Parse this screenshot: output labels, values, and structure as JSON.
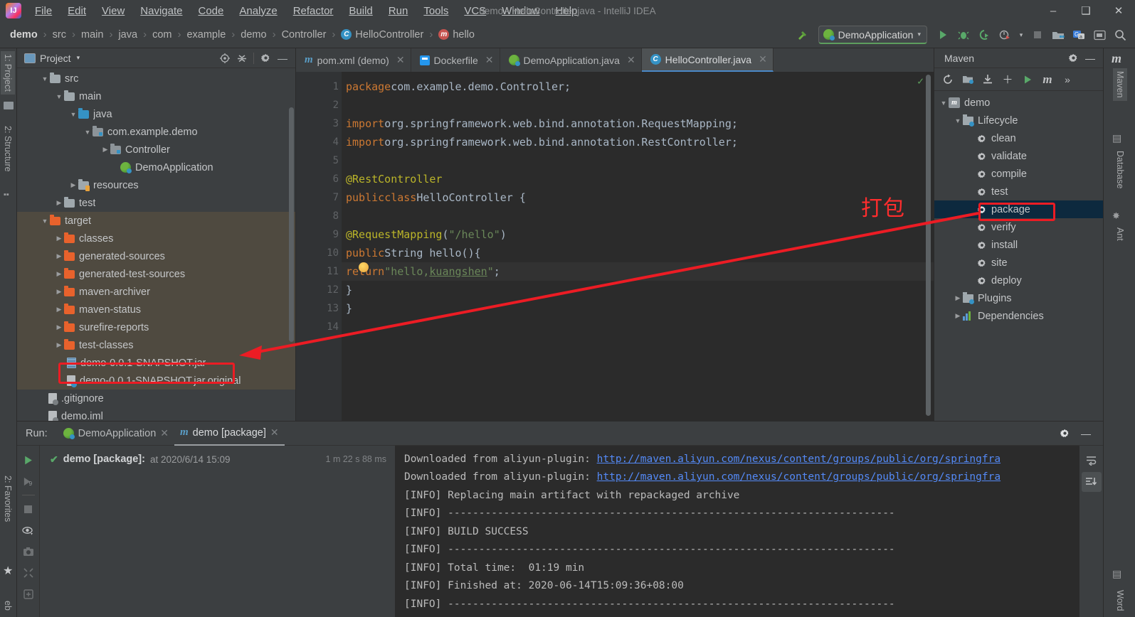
{
  "window": {
    "title": "demo - HelloController.java - IntelliJ IDEA",
    "logo_text": "IJ",
    "minimize": "–",
    "maximize": "❑",
    "close": "✕"
  },
  "menubar": {
    "items": [
      {
        "label": "File"
      },
      {
        "label": "Edit"
      },
      {
        "label": "View"
      },
      {
        "label": "Navigate"
      },
      {
        "label": "Code"
      },
      {
        "label": "Analyze"
      },
      {
        "label": "Refactor"
      },
      {
        "label": "Build"
      },
      {
        "label": "Run"
      },
      {
        "label": "Tools"
      },
      {
        "label": "VCS"
      },
      {
        "label": "Window"
      },
      {
        "label": "Help"
      }
    ]
  },
  "breadcrumb": {
    "items": [
      {
        "label": "demo",
        "icon": ""
      },
      {
        "label": "src",
        "icon": ""
      },
      {
        "label": "main",
        "icon": ""
      },
      {
        "label": "java",
        "icon": ""
      },
      {
        "label": "com",
        "icon": ""
      },
      {
        "label": "example",
        "icon": ""
      },
      {
        "label": "demo",
        "icon": ""
      },
      {
        "label": "Controller",
        "icon": ""
      },
      {
        "label": "HelloController",
        "icon": "class-icon"
      },
      {
        "label": "hello",
        "icon": "method-icon"
      }
    ],
    "separator": "›"
  },
  "toolbar": {
    "build_icon": "hammer-icon",
    "run_config": "DemoApplication",
    "run_config_caret": "▾",
    "run_icon": "▶",
    "debug_icon": "debug-icon",
    "run_coverage_icon": "run-with-coverage-icon",
    "profile_icon": "profiler-icon",
    "profile_caret": "▾",
    "stop_icon": "■",
    "project_structure_icon": "project-structure-icon",
    "translate_icon": "translate-icon",
    "terminal_icon": "terminal-icon",
    "search_icon": "search-icon"
  },
  "left_stripe": {
    "project_label": "1: Project",
    "structure_label": "2: Structure",
    "favorites_label": "2: Favorites",
    "web_label": "eb"
  },
  "right_stripe": {
    "maven_label": "Maven",
    "database_label": "Database",
    "ant_label": "Ant",
    "word_label": "Word",
    "maven_icon": "m"
  },
  "project_panel": {
    "title": "Project",
    "caret": "▾",
    "locate_icon": "locate-in-tree-icon",
    "collapse_icon": "collapse-all-icon",
    "settings_icon": "gear-icon",
    "hide_icon": "—",
    "tree": [
      {
        "label": "src",
        "depth": 2,
        "arrow": "open",
        "icon": "folder-grey"
      },
      {
        "label": "main",
        "depth": 3,
        "arrow": "open",
        "icon": "folder-grey"
      },
      {
        "label": "java",
        "depth": 4,
        "arrow": "open",
        "icon": "folder-blue"
      },
      {
        "label": "com.example.demo",
        "depth": 5,
        "arrow": "open",
        "icon": "folder-pkg"
      },
      {
        "label": "Controller",
        "depth": 6,
        "arrow": "closed",
        "icon": "folder-pkg"
      },
      {
        "label": "DemoApplication",
        "depth": 7,
        "arrow": "none",
        "icon": "spring-icon"
      },
      {
        "label": "resources",
        "depth": 4,
        "arrow": "closed",
        "icon": "folder-res"
      },
      {
        "label": "test",
        "depth": 3,
        "arrow": "closed",
        "icon": "folder-grey"
      },
      {
        "label": "target",
        "depth": 2,
        "arrow": "open",
        "icon": "folder-orange",
        "highlight": true
      },
      {
        "label": "classes",
        "depth": 3,
        "arrow": "closed",
        "icon": "folder-orange",
        "highlight": true
      },
      {
        "label": "generated-sources",
        "depth": 3,
        "arrow": "closed",
        "icon": "folder-orange",
        "highlight": true
      },
      {
        "label": "generated-test-sources",
        "depth": 3,
        "arrow": "closed",
        "icon": "folder-orange",
        "highlight": true
      },
      {
        "label": "maven-archiver",
        "depth": 3,
        "arrow": "closed",
        "icon": "folder-orange",
        "highlight": true
      },
      {
        "label": "maven-status",
        "depth": 3,
        "arrow": "closed",
        "icon": "folder-orange",
        "highlight": true
      },
      {
        "label": "surefire-reports",
        "depth": 3,
        "arrow": "closed",
        "icon": "folder-orange",
        "highlight": true
      },
      {
        "label": "test-classes",
        "depth": 3,
        "arrow": "closed",
        "icon": "folder-orange",
        "highlight": true
      },
      {
        "label": "demo-0.0.1-SNAPSHOT.jar",
        "depth": 4,
        "arrow": "none",
        "icon": "jar-icon",
        "highlight": true,
        "boxed": true
      },
      {
        "label": "demo-0.0.1-SNAPSHOT.jar.original",
        "depth": 4,
        "arrow": "none",
        "icon": "file-icon",
        "highlight": true
      },
      {
        "label": ".gitignore",
        "depth": 2,
        "arrow": "none",
        "icon": "file-icon"
      },
      {
        "label": "demo.iml",
        "depth": 2,
        "arrow": "none",
        "icon": "file-icon"
      }
    ]
  },
  "editor": {
    "tabs": [
      {
        "label": "pom.xml (demo)",
        "icon": "maven-m-icon",
        "active": false,
        "close": "✕"
      },
      {
        "label": "Dockerfile",
        "icon": "docker-icon",
        "active": false,
        "close": "✕"
      },
      {
        "label": "DemoApplication.java",
        "icon": "spring-icon",
        "active": false,
        "close": "✕"
      },
      {
        "label": "HelloController.java",
        "icon": "class-icon",
        "active": true,
        "close": "✕"
      }
    ],
    "line_numbers": [
      "1",
      "2",
      "3",
      "4",
      "5",
      "6",
      "7",
      "8",
      "9",
      "10",
      "11",
      "12",
      "13",
      "14"
    ],
    "lines": [
      {
        "n": 1,
        "html": "<span class=\"kw\">package</span> <span class=\"plain\">com.example.demo.Controller;</span>"
      },
      {
        "n": 2,
        "html": ""
      },
      {
        "n": 3,
        "html": "<span class=\"kw\">import</span> <span class=\"plain\">org.springframework.web.bind.annotation.</span><span class=\"cls\">RequestMapping</span><span class=\"plain\">;</span>"
      },
      {
        "n": 4,
        "html": "<span class=\"kw\">import</span> <span class=\"plain\">org.springframework.web.bind.annotation.</span><span class=\"cls\">RestController</span><span class=\"plain\">;</span>"
      },
      {
        "n": 5,
        "html": ""
      },
      {
        "n": 6,
        "html": "<span class=\"ann\">@RestController</span>"
      },
      {
        "n": 7,
        "html": "<span class=\"kw\">public</span> <span class=\"kw\">class</span> <span class=\"plain\">HelloController {</span>"
      },
      {
        "n": 8,
        "html": ""
      },
      {
        "n": 9,
        "html": "    <span class=\"ann\">@RequestMapping</span><span class=\"plain\">(</span><span class=\"str\">\"/hello\"</span><span class=\"plain\">)</span>"
      },
      {
        "n": 10,
        "html": "    <span class=\"kw\">public</span> <span class=\"plain\">String </span><span class=\"plain\">hello(){</span>"
      },
      {
        "n": 11,
        "html": "        <span class=\"kw\">return</span> <span class=\"str\">\"hello,</span><span class=\"ident-u\">kuangshen</span><span class=\"str\">\"</span><span class=\"plain\">;</span>"
      },
      {
        "n": 12,
        "html": "    <span class=\"plain\">}</span>"
      },
      {
        "n": 13,
        "html": "<span class=\"plain\">}</span>"
      },
      {
        "n": 14,
        "html": ""
      }
    ],
    "inspection_ok": "✓"
  },
  "maven_panel": {
    "title": "Maven",
    "settings_icon": "gear-icon",
    "hide_icon": "—",
    "toolbar": {
      "reload_icon": "↻",
      "add_maven_projects_icon": "add-maven-project-icon",
      "download_sources_icon": "download-icon",
      "add_icon": "＋",
      "run_icon": "▶",
      "execute_goal_icon": "m",
      "more_icon": "»"
    },
    "tree": [
      {
        "label": "demo",
        "depth": 0,
        "arrow": "open",
        "icon": "maven-project-icon"
      },
      {
        "label": "Lifecycle",
        "depth": 1,
        "arrow": "open",
        "icon": "lifecycle-icon"
      },
      {
        "label": "clean",
        "depth": 2,
        "arrow": "none",
        "icon": "gear-icon"
      },
      {
        "label": "validate",
        "depth": 2,
        "arrow": "none",
        "icon": "gear-icon"
      },
      {
        "label": "compile",
        "depth": 2,
        "arrow": "none",
        "icon": "gear-icon"
      },
      {
        "label": "test",
        "depth": 2,
        "arrow": "none",
        "icon": "gear-icon"
      },
      {
        "label": "package",
        "depth": 2,
        "arrow": "none",
        "icon": "gear-icon",
        "selected": true,
        "boxed": true
      },
      {
        "label": "verify",
        "depth": 2,
        "arrow": "none",
        "icon": "gear-icon"
      },
      {
        "label": "install",
        "depth": 2,
        "arrow": "none",
        "icon": "gear-icon"
      },
      {
        "label": "site",
        "depth": 2,
        "arrow": "none",
        "icon": "gear-icon"
      },
      {
        "label": "deploy",
        "depth": 2,
        "arrow": "none",
        "icon": "gear-icon"
      },
      {
        "label": "Plugins",
        "depth": 1,
        "arrow": "closed",
        "icon": "lifecycle-icon"
      },
      {
        "label": "Dependencies",
        "depth": 1,
        "arrow": "closed",
        "icon": "dependencies-icon"
      }
    ]
  },
  "run_panel": {
    "label": "Run:",
    "tabs": [
      {
        "label": "DemoApplication",
        "icon": "spring-icon",
        "active": false,
        "close": "✕"
      },
      {
        "label": "demo [package]",
        "icon": "maven-m-icon",
        "active": true,
        "close": "✕"
      }
    ],
    "settings_icon": "gear-icon",
    "hide_icon": "—",
    "gutter_icons": {
      "rerun": "▶",
      "rerun_failed": "rerun-failed-icon",
      "stop": "■",
      "toggle_visibility": "eye-icon",
      "export": "camera-icon",
      "expand": "expand-icon",
      "print": "print-icon"
    },
    "tree_row": {
      "status_icon": "✔",
      "name": "demo [package]:",
      "at": "at 2020/6/14 15:09",
      "duration": "1 m 22 s 88 ms"
    },
    "console_lines": [
      {
        "prefix": "Downloaded from aliyun-plugin: ",
        "link": "http://maven.aliyun.com/nexus/content/groups/public/org/springfra"
      },
      {
        "prefix": "Downloaded from aliyun-plugin: ",
        "link": "http://maven.aliyun.com/nexus/content/groups/public/org/springfra"
      },
      {
        "prefix": "[INFO] Replacing main artifact with repackaged archive",
        "link": ""
      },
      {
        "prefix": "[INFO] ------------------------------------------------------------------------",
        "link": ""
      },
      {
        "prefix": "[INFO] BUILD SUCCESS",
        "link": ""
      },
      {
        "prefix": "[INFO] ------------------------------------------------------------------------",
        "link": ""
      },
      {
        "prefix": "[INFO] Total time:  01:19 min",
        "link": ""
      },
      {
        "prefix": "[INFO] Finished at: 2020-06-14T15:09:36+08:00",
        "link": ""
      },
      {
        "prefix": "[INFO] ------------------------------------------------------------------------",
        "link": ""
      }
    ],
    "console_gutter": {
      "soft_wrap": "soft-wrap-icon",
      "scroll_to_end": "scroll-to-end-icon"
    }
  },
  "annotation": {
    "text": "打包",
    "color": "#ff2d2d"
  },
  "colors": {
    "accent_blue": "#3592c4",
    "annotation_red": "#ec1c24",
    "selection_blue": "#0d293e",
    "target_highlight": "#4f4a40",
    "editor_bg": "#2b2b2b",
    "panel_bg": "#3c3f41",
    "link_blue": "#548af7",
    "string_green": "#6a8759",
    "keyword_orange": "#cc7832",
    "annotation_yellow": "#bbb529"
  }
}
